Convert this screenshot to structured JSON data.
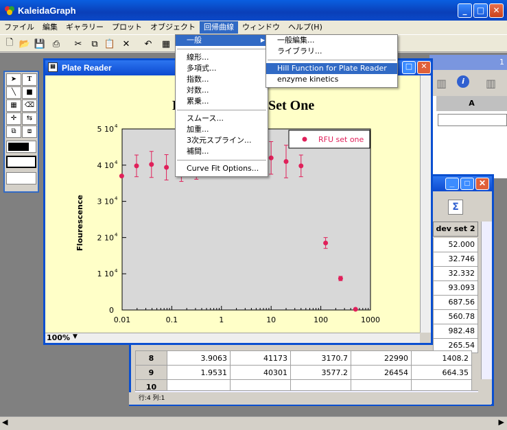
{
  "app": {
    "title": "KaleidaGraph"
  },
  "menubar": {
    "items": [
      "ファイル",
      "編集",
      "ギャラリー",
      "プロット",
      "オブジェクト",
      "回帰曲線",
      "ウィンドウ",
      "ヘルプ(H)"
    ],
    "active_index": 5
  },
  "regression_menu": {
    "items": [
      "一般",
      "線形...",
      "多項式...",
      "指数...",
      "対数...",
      "累乗...",
      "スムース...",
      "加重...",
      "3次元スプライン...",
      "補間...",
      "Curve Fit Options..."
    ]
  },
  "general_submenu": {
    "items": [
      "一般編集...",
      "ライブラリ...",
      "Hill Function for Plate Reader",
      "enzyme kinetics"
    ],
    "highlight_index": 2
  },
  "plate_window": {
    "title": "Plate Reader",
    "zoom": "100%"
  },
  "plot": {
    "title_left": "P",
    "title_right": "Set One",
    "legend": "RFU set one",
    "ylabel": "Flourescence",
    "xticks": [
      "0.01",
      "0.1",
      "1",
      "10",
      "100",
      "1000"
    ],
    "yticks": [
      "0",
      "1 10",
      "2 10",
      "3 10",
      "4 10",
      "5 10"
    ],
    "yexp": "4",
    "colors": {
      "marker": "#e0205a",
      "plot_bg": "#d8d8d8",
      "frame_bg": "#ffffc8"
    }
  },
  "chart_data": {
    "type": "scatter",
    "title": "P... Set One",
    "xlabel": "",
    "ylabel": "Flourescence",
    "xscale": "log",
    "xlim": [
      0.01,
      1000
    ],
    "ylim": [
      0,
      50000
    ],
    "series": [
      {
        "name": "RFU set one",
        "x": [
          0.0098,
          0.0195,
          0.039,
          0.078,
          0.156,
          0.3125,
          0.625,
          1.25,
          2.5,
          5,
          10,
          20,
          40,
          125,
          250,
          500
        ],
        "y": [
          37000,
          39800,
          40200,
          39400,
          39000,
          39600,
          40100,
          40300,
          41200,
          41500,
          42000,
          41000,
          39800,
          18500,
          8700,
          200
        ],
        "err": [
          0,
          3000,
          3600,
          3500,
          3500,
          3500,
          3000,
          3000,
          3000,
          3000,
          4500,
          4500,
          3000,
          1500,
          600,
          0
        ]
      }
    ]
  },
  "small_window": {
    "header": "A"
  },
  "data_window": {
    "column_header": "dev set 2",
    "right_col_top": [
      "52.000",
      "32.746",
      "32.332",
      "93.093",
      "687.56",
      "560.78",
      "982.48",
      "265.54"
    ],
    "rows": [
      {
        "num": "8",
        "cells": [
          "3.9063",
          "41173",
          "3170.7",
          "22990",
          "1408.2"
        ]
      },
      {
        "num": "9",
        "cells": [
          "1.9531",
          "40301",
          "3577.2",
          "26454",
          "664.35"
        ]
      },
      {
        "num": "10",
        "cells": [
          "",
          "",
          "",
          "",
          ""
        ]
      }
    ],
    "status": "行:4   列:1"
  }
}
